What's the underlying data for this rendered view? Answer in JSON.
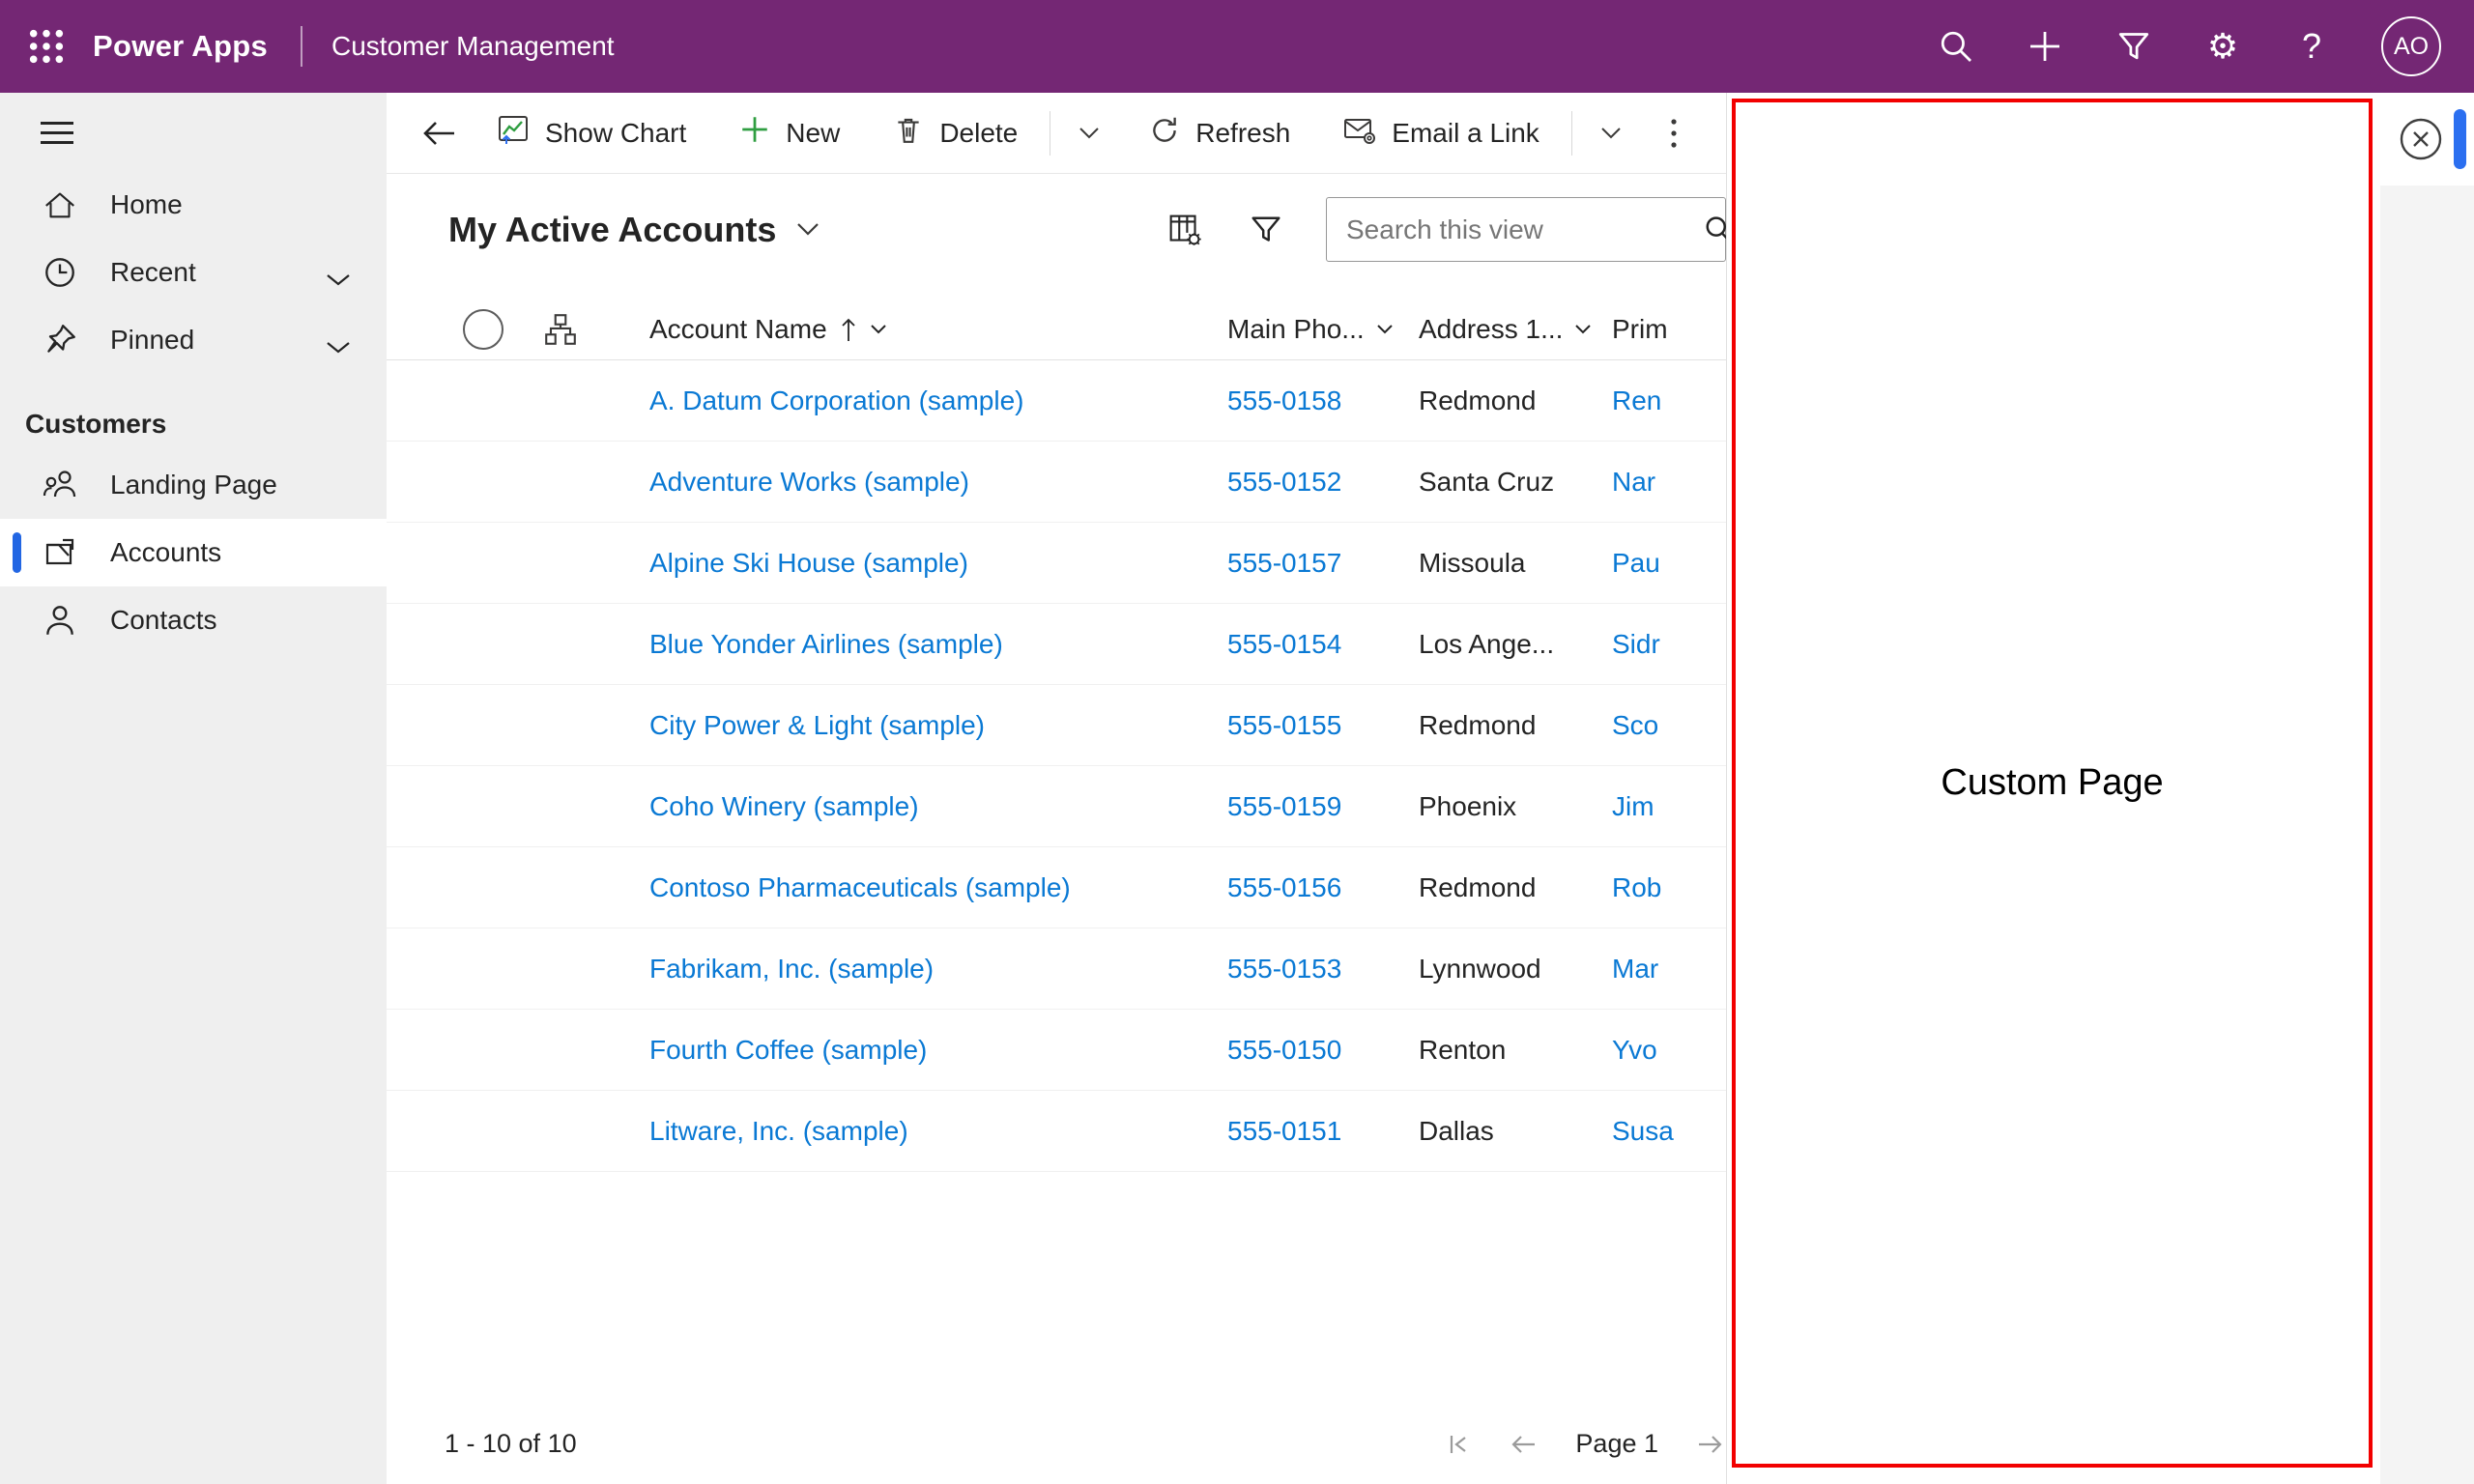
{
  "app_header": {
    "app_name": "Power Apps",
    "environment_title": "Customer Management",
    "avatar_initials": "AO",
    "gear_glyph": "⚙",
    "help_glyph": "?"
  },
  "sidebar": {
    "home": "Home",
    "recent": "Recent",
    "pinned": "Pinned",
    "group_label": "Customers",
    "landing_page": "Landing Page",
    "accounts": "Accounts",
    "contacts": "Contacts"
  },
  "command_bar": {
    "show_chart": "Show Chart",
    "new": "New",
    "delete": "Delete",
    "refresh": "Refresh",
    "email_a_link": "Email a Link"
  },
  "view": {
    "title": "My Active Accounts",
    "search_placeholder": "Search this view"
  },
  "grid": {
    "columns": {
      "account_name": "Account Name",
      "main_phone": "Main Pho...",
      "address_city": "Address 1...",
      "primary_contact": "Prim"
    },
    "rows": [
      {
        "account_name": "A. Datum Corporation (sample)",
        "main_phone": "555-0158",
        "city": "Redmond",
        "primary_contact": "Ren"
      },
      {
        "account_name": "Adventure Works (sample)",
        "main_phone": "555-0152",
        "city": "Santa Cruz",
        "primary_contact": "Nar"
      },
      {
        "account_name": "Alpine Ski House (sample)",
        "main_phone": "555-0157",
        "city": "Missoula",
        "primary_contact": "Pau"
      },
      {
        "account_name": "Blue Yonder Airlines (sample)",
        "main_phone": "555-0154",
        "city": "Los Ange...",
        "primary_contact": "Sidr"
      },
      {
        "account_name": "City Power & Light (sample)",
        "main_phone": "555-0155",
        "city": "Redmond",
        "primary_contact": "Sco"
      },
      {
        "account_name": "Coho Winery (sample)",
        "main_phone": "555-0159",
        "city": "Phoenix",
        "primary_contact": "Jim"
      },
      {
        "account_name": "Contoso Pharmaceuticals (sample)",
        "main_phone": "555-0156",
        "city": "Redmond",
        "primary_contact": "Rob"
      },
      {
        "account_name": "Fabrikam, Inc. (sample)",
        "main_phone": "555-0153",
        "city": "Lynnwood",
        "primary_contact": "Mar"
      },
      {
        "account_name": "Fourth Coffee (sample)",
        "main_phone": "555-0150",
        "city": "Renton",
        "primary_contact": "Yvo"
      },
      {
        "account_name": "Litware, Inc. (sample)",
        "main_phone": "555-0151",
        "city": "Dallas",
        "primary_contact": "Susa"
      }
    ]
  },
  "footer": {
    "record_range": "1 - 10 of 10",
    "page_label": "Page 1"
  },
  "panel": {
    "label": "Custom Page"
  },
  "colors": {
    "header_purple": "#742774",
    "sidebar_gray": "#efefef",
    "selected_accent_blue": "#2266e3",
    "link_blue": "#0a79d4",
    "new_icon_green": "#2f9e41",
    "panel_border_red": "#f20000",
    "panel_scrollbar_blue": "#2b6ff0"
  },
  "icon_names": [
    "waffle-icon",
    "search-icon",
    "add-icon",
    "filter-icon",
    "gear-icon",
    "help-icon",
    "hamburger-icon",
    "home-icon",
    "clock-icon",
    "pin-icon",
    "chevron-down-icon",
    "people-icon",
    "accounts-entity-icon",
    "person-icon",
    "back-arrow-icon",
    "show-chart-icon",
    "plus-icon",
    "trash-icon",
    "refresh-icon",
    "email-link-icon",
    "more-vertical-icon",
    "edit-columns-icon",
    "sort-ascending-icon",
    "hierarchy-icon",
    "first-page-icon",
    "previous-page-icon",
    "next-page-icon",
    "close-circle-icon"
  ]
}
